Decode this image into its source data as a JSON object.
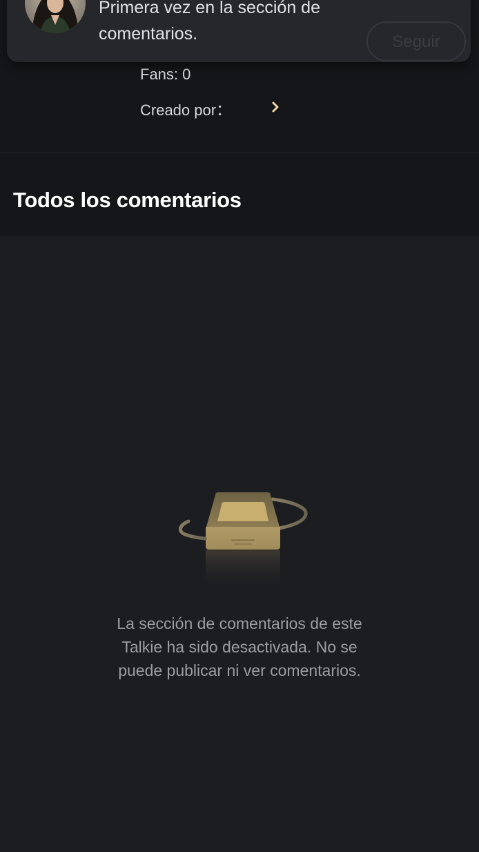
{
  "profile": {
    "fans_label": "Fans: 0",
    "created_by_label": "Creado por："
  },
  "notification": {
    "message": "Primera vez en la sección de comentarios.",
    "follow_label": "Seguir"
  },
  "comments": {
    "title": "Todos los comentarios",
    "empty_message": "La sección de comentarios de este Talkie ha sido desactivada. No se puede publicar ni ver comentarios."
  },
  "colors": {
    "background": "#1c1d21",
    "header_background": "#151619",
    "accent": "#f2d9a0",
    "tray_gold": "#a89262"
  },
  "icons": {
    "creator_chevron": "chevron-right-icon",
    "empty_state": "empty-tray-icon"
  }
}
